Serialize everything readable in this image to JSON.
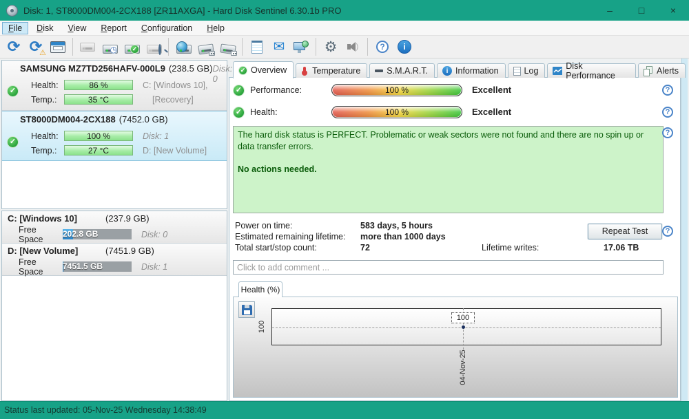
{
  "window": {
    "title": "Disk: 1, ST8000DM004-2CX188 [ZR11AXGA]  -  Hard Disk Sentinel 6.30.1b PRO",
    "controls": {
      "minimize": "–",
      "maximize": "□",
      "close": "×"
    }
  },
  "glyphs": {
    "check": "✓",
    "refresh": "⟳",
    "warning": "⚠",
    "clock": "◷",
    "mail": "✉",
    "gear": "⚙",
    "question": "?",
    "info": "i",
    "wave": ")"
  },
  "menu": {
    "items": [
      "File",
      "Disk",
      "View",
      "Report",
      "Configuration",
      "Help"
    ]
  },
  "toolbar": {
    "icon_names": [
      "refresh",
      "refresh-warning",
      "disk-report",
      "disk-disabled",
      "disk-schedule",
      "disk-test-ok",
      "disk-surface-test",
      "network-disk",
      "disk-hardware",
      "disk-eject",
      "report-notepad",
      "send-mail",
      "remote-monitor",
      "settings-gear",
      "sound",
      "help",
      "about-info"
    ]
  },
  "sidebar": {
    "disks": [
      {
        "name": "SAMSUNG MZ7TD256HAFV-000L9",
        "capacity": "(238.5 GB)",
        "disk_no": "Disk: 0",
        "health_label": "Health:",
        "health_value": "86 %",
        "temp_label": "Temp.:",
        "temp_value": "35 °C",
        "line1_right": "C: [Windows 10],",
        "line2_right": "[Recovery]"
      },
      {
        "name": "ST8000DM004-2CX188",
        "capacity": "(7452.0 GB)",
        "health_label": "Health:",
        "health_value": "100 %",
        "temp_label": "Temp.:",
        "temp_value": "27 °C",
        "line1_right": "Disk: 1",
        "line2_right": "D: [New Volume]"
      }
    ],
    "partitions": [
      {
        "name": "C: [Windows 10]",
        "capacity": "(237.9 GB)",
        "free_label": "Free Space",
        "free_value": "202.8 GB",
        "disk_no": "Disk: 0",
        "used_percent": 15
      },
      {
        "name": "D: [New Volume]",
        "capacity": "(7451.9 GB)",
        "free_label": "Free Space",
        "free_value": "7451.5 GB",
        "disk_no": "Disk: 1",
        "used_percent": 1
      }
    ]
  },
  "main": {
    "tabs": [
      {
        "label": "Overview"
      },
      {
        "label": "Temperature"
      },
      {
        "label": "S.M.A.R.T."
      },
      {
        "label": "Information"
      },
      {
        "label": "Log"
      },
      {
        "label": "Disk Performance"
      },
      {
        "label": "Alerts"
      }
    ],
    "rows": [
      {
        "label": "Performance:",
        "value": "100 %",
        "rating": "Excellent"
      },
      {
        "label": "Health:",
        "value": "100 %",
        "rating": "Excellent"
      }
    ],
    "status_message_p1": "The hard disk status is PERFECT. Problematic or weak sectors were not found and there are no spin up or data transfer errors.",
    "status_message_p2": "No actions needed.",
    "stats": {
      "power_on_label": "Power on time:",
      "power_on_value": "583 days, 5 hours",
      "remaining_label": "Estimated remaining lifetime:",
      "remaining_value": "more than 1000 days",
      "startstop_label": "Total start/stop count:",
      "startstop_value": "72",
      "writes_label": "Lifetime writes:",
      "writes_value": "17.06 TB"
    },
    "repeat_test_label": "Repeat Test",
    "comment_placeholder": "Click to add comment ...",
    "graph_tab_label": "Health (%)"
  },
  "chart_data": {
    "type": "line",
    "title": "Health (%)",
    "x": [
      "04-Nov-25"
    ],
    "series": [
      {
        "name": "Health %",
        "values": [
          100
        ]
      }
    ],
    "y_ticks": [
      100
    ],
    "point_labels": [
      "100"
    ],
    "xlabel": "",
    "ylabel": "",
    "grid": "dashed horizontal gridline at 100 and dashed vertical gridline at 04-Nov-25",
    "legend_position": "none"
  },
  "statusbar": {
    "text": "Status last updated: 05-Nov-25 Wednesday 14:38:49"
  },
  "colors": {
    "titlebar": "#17a287",
    "statusbar": "#17a287",
    "selected_disk_bg": "#d5eef9",
    "health_minibar_green": "#9ce89c",
    "used_space_blue": "#2f96d8",
    "status_box_bg": "#cdf3c9",
    "status_box_text": "#0a5c0a",
    "gauge_gradient": [
      "#e2574c",
      "#f3d53e",
      "#39c639"
    ]
  }
}
